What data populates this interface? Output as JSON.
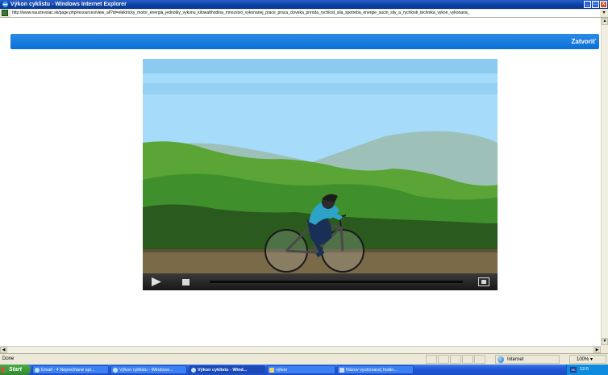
{
  "window": {
    "title": "Výkon cyklistu - Windows Internet Explorer",
    "controls": {
      "minimize": "_",
      "maximize": "□",
      "close": "x"
    }
  },
  "address": {
    "url": "http://www.nauctevsiac.sk/page.php/resources/view_all?id=elektricky_motor_energia_jednotky_vykonu_kilowatthodina_mnozstvo_vykonanej_prace_praca_cloveka_priroda_rychlost_sila_spotreba_energie_sucin_sily_a_rychlosti_technika_vykon_vykonana_"
  },
  "page": {
    "close_label": "Zatvoriť"
  },
  "player": {
    "progress": 0.0
  },
  "status": {
    "left_text": "Done",
    "zone_label": "Internet",
    "zoom": "100%"
  },
  "taskbar": {
    "start_label": "Start",
    "tasks": [
      "Email - 4 Neprečítané spr...",
      "Výkon cyklistu - Windows...",
      "Výkon cyklistu - Wind...",
      "výkon",
      "Názov vyučovacej hodin..."
    ],
    "tray_icon": "SK",
    "clock": "12:0"
  },
  "colors": {
    "accent": "#0a6fd6",
    "sky": "#a8dcfa",
    "grass": "#3d8f2a",
    "road": "#7a6a48"
  }
}
